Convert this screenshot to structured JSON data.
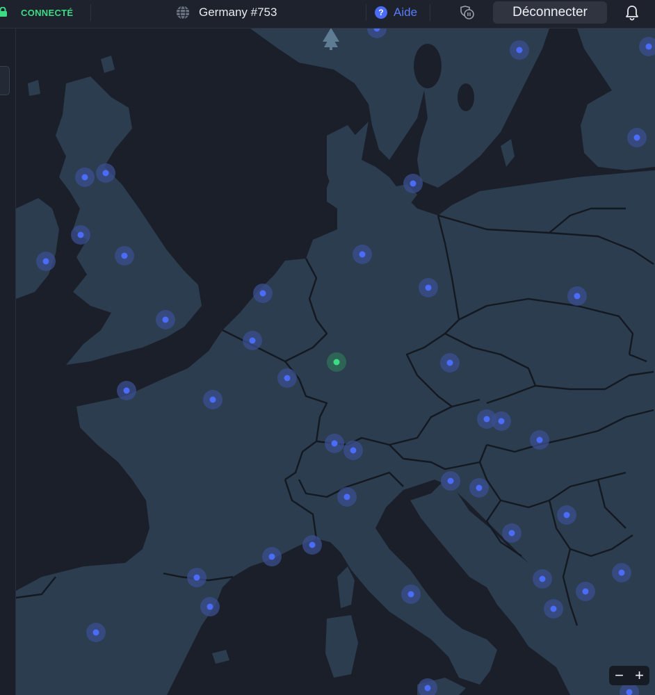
{
  "topbar": {
    "status": "CONNECTÉ",
    "server": "Germany #753",
    "help_label": "Aide",
    "disconnect_label": "Déconnecter"
  },
  "zoom": {
    "out_label": "−",
    "in_label": "+"
  },
  "icons": {
    "lock": "lock-icon",
    "globe": "globe-icon",
    "help": "question-circle-icon",
    "pause": "shield-pause-icon",
    "bell": "bell-icon",
    "tree": "tree-icon"
  },
  "colors": {
    "background": "#1b1f2a",
    "land": "#2b3d4f",
    "border": "#141820",
    "connected": "#3ddc84",
    "server_pin": "#4b6cf7",
    "server_halo": "#3b4f8f",
    "active_pin": "#3ddc84",
    "accent": "#5b7cfa"
  },
  "map": {
    "active_location": "Germany #753",
    "server_count": 48
  }
}
